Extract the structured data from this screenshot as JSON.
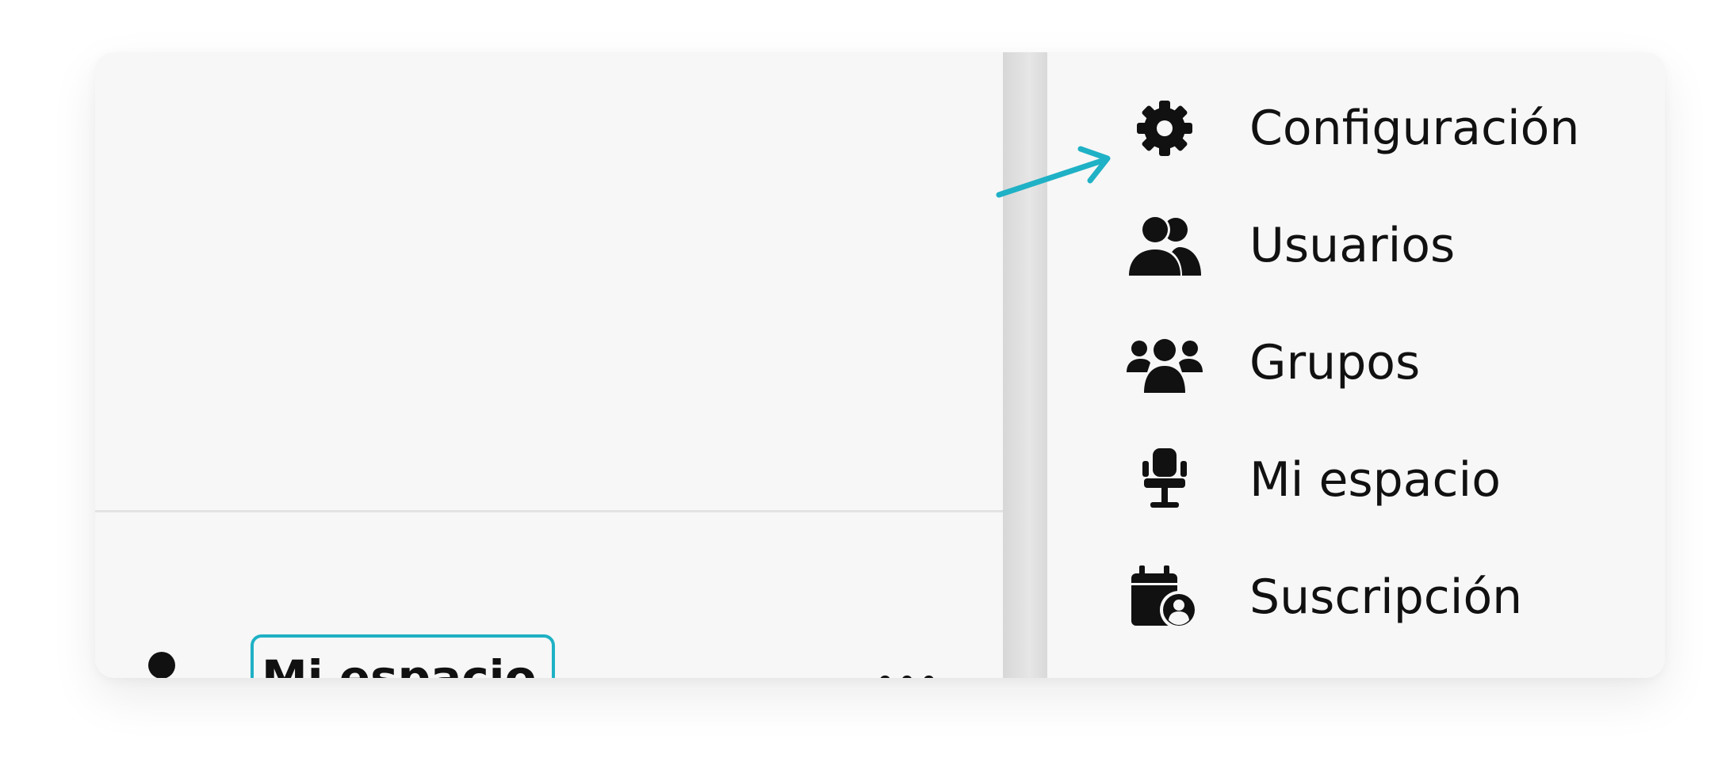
{
  "footer": {
    "workspace_label": "Mi espacio",
    "more_label": "•••",
    "icon": "user-gear-icon"
  },
  "menu": {
    "items": [
      {
        "label": "Configuración",
        "icon": "gear-icon"
      },
      {
        "label": "Usuarios",
        "icon": "users-icon"
      },
      {
        "label": "Grupos",
        "icon": "group-icon"
      },
      {
        "label": "Mi espacio",
        "icon": "office-chair-icon"
      },
      {
        "label": "Suscripción",
        "icon": "calendar-user-icon"
      }
    ]
  },
  "colors": {
    "accent": "#1fb1c5",
    "panel_bg": "#f7f7f7",
    "text": "#111111"
  }
}
